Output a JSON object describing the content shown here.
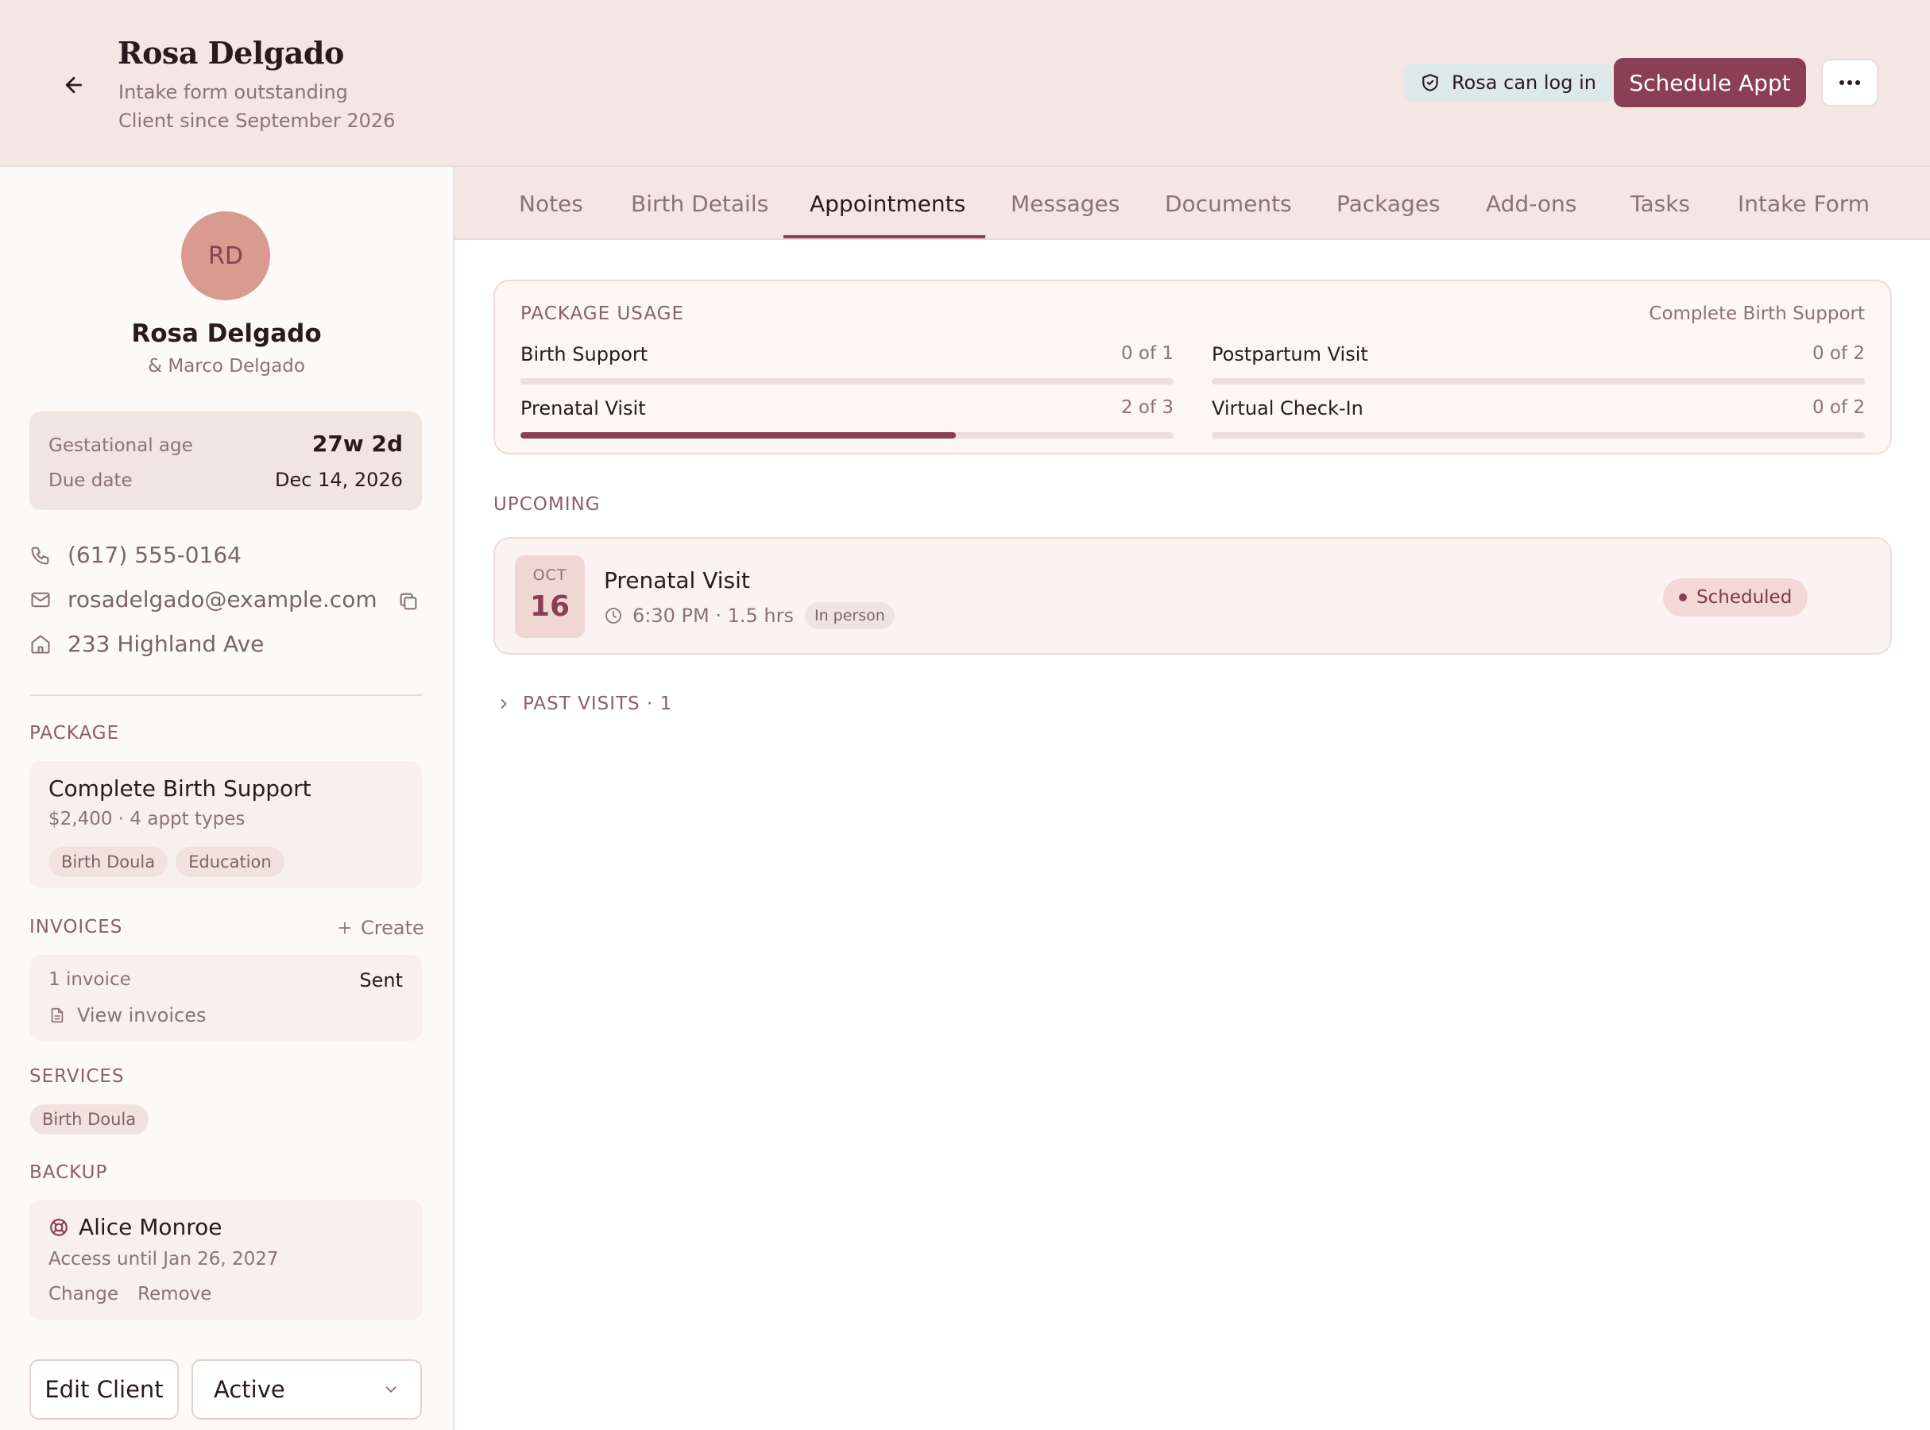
{
  "header": {
    "client_name": "Rosa Delgado",
    "subtitle_1": "Intake form outstanding",
    "subtitle_2": "Client since September 2026",
    "login_badge": "Rosa can log in",
    "schedule_button": "Schedule Appt",
    "more_button": "⋯"
  },
  "sidebar": {
    "avatar_initials": "RD",
    "name": "Rosa Delgado",
    "partner": "& Marco Delgado",
    "gestation": {
      "age_label": "Gestational age",
      "age_value": "27w 2d",
      "due_label": "Due date",
      "due_value": "Dec 14, 2026"
    },
    "contact": {
      "phone": "(617) 555-0164",
      "email": "rosadelgado@example.com",
      "address": "233 Highland Ave"
    },
    "package": {
      "section_title": "PACKAGE",
      "name": "Complete Birth Support",
      "meta": "$2,400 · 4 appt types",
      "tags": [
        "Birth Doula",
        "Education"
      ]
    },
    "invoices": {
      "section_title": "INVOICES",
      "create_label": "Create",
      "count": "1 invoice",
      "status": "Sent",
      "view_label": "View invoices"
    },
    "services": {
      "section_title": "SERVICES",
      "tags": [
        "Birth Doula"
      ]
    },
    "backup": {
      "section_title": "BACKUP",
      "name": "Alice Monroe",
      "access": "Access until Jan 26, 2027",
      "change_label": "Change",
      "remove_label": "Remove"
    },
    "edit_button": "Edit Client",
    "status_select": "Active"
  },
  "tabs": [
    {
      "label": "Notes"
    },
    {
      "label": "Birth Details"
    },
    {
      "label": "Appointments",
      "active": true
    },
    {
      "label": "Messages"
    },
    {
      "label": "Documents"
    },
    {
      "label": "Packages"
    },
    {
      "label": "Add-ons"
    },
    {
      "label": "Tasks"
    },
    {
      "label": "Intake Form"
    }
  ],
  "usage": {
    "title": "PACKAGE USAGE",
    "package_name": "Complete Birth Support",
    "items": [
      {
        "label": "Birth Support",
        "count": "0 of 1",
        "fraction": 0.0
      },
      {
        "label": "Postpartum Visit",
        "count": "0 of 2",
        "fraction": 0.0
      },
      {
        "label": "Prenatal Visit",
        "count": "2 of 3",
        "fraction": 0.667
      },
      {
        "label": "Virtual Check-In",
        "count": "0 of 2",
        "fraction": 0.0
      }
    ]
  },
  "upcoming": {
    "title": "UPCOMING",
    "appointment": {
      "month": "OCT",
      "day": "16",
      "title": "Prenatal Visit",
      "time": "6:30 PM · 1.5 hrs",
      "location": "In person",
      "status": "Scheduled"
    }
  },
  "past_visits": "PAST VISITS · 1",
  "colors": {
    "accent": "#8a3f56",
    "header_bg": "#f3e6e3",
    "avatar_bg": "#d99a8f",
    "login_badge_bg": "#dde9e8"
  }
}
